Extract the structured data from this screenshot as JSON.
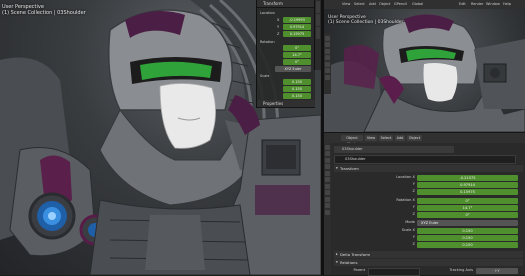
{
  "left_viewport": {
    "overlay_lines": [
      "User Perspective",
      "(1) Scene Collection | 03Shoulder"
    ],
    "npanel": {
      "header": "Transform",
      "location_label": "Location",
      "location_axes": [
        "X",
        "Y",
        "Z"
      ],
      "location_values": [
        "-0.19993",
        "0.97914",
        "0.15975"
      ],
      "rotation_label": "Rotation",
      "rotation_values": [
        "0°",
        "14.7°",
        "0°"
      ],
      "mode_value": "XYZ Euler",
      "scale_label": "Scale",
      "scale_values": [
        "0.150",
        "0.150",
        "0.150"
      ],
      "properties_header": "Properties"
    }
  },
  "right_viewport": {
    "menu": [
      "View",
      "Select",
      "Add",
      "Object",
      "GPencil",
      "Global"
    ],
    "menu_right": [
      "Edit",
      "Render",
      "Window",
      "Help"
    ],
    "overlay_lines": [
      "User Perspective",
      "(1) Scene Collection | 03Shoulder"
    ]
  },
  "properties_editor": {
    "header_buttons": [
      "Object Mode",
      "View",
      "Select",
      "Add",
      "Object"
    ],
    "object_name": "03Shoulder",
    "data_name": "03Shoulder",
    "transform_header": "Transform",
    "location_label": "Location X",
    "axes": [
      "Y",
      "Z"
    ],
    "location_values": [
      "-0.21575",
      "0.97914",
      "0.15975"
    ],
    "rotation_label": "Rotation X",
    "rotation_values": [
      "0°",
      "14.7°",
      "0°"
    ],
    "mode_label": "Mode",
    "mode_value": "XYZ Euler",
    "scale_label": "Scale X",
    "scale_values": [
      "0.150",
      "0.150",
      "0.150"
    ],
    "delta_header": "Delta Transform",
    "relations_header": "Relations",
    "parent_label": "Parent",
    "tracking_label": "Tracking Axis",
    "tracking_value": "+Y"
  },
  "colors": {
    "accent_green": "#4f8f2d",
    "visor_green": "#2fa33a",
    "panel": "#2a2a2a"
  }
}
